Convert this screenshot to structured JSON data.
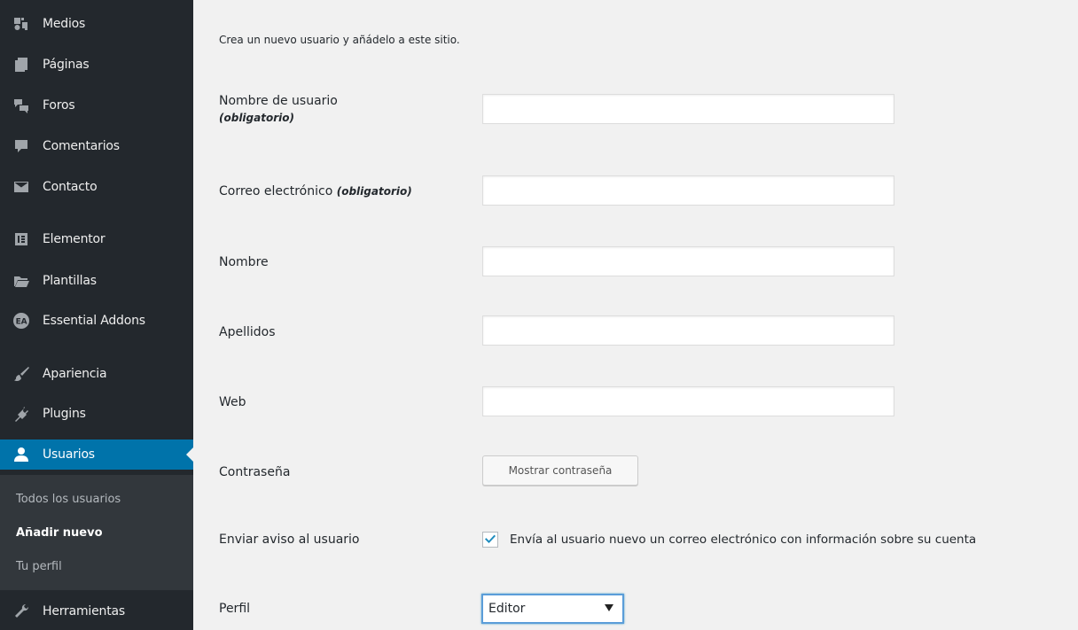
{
  "sidebar": {
    "items": [
      {
        "label": "Medios",
        "icon": "media-icon"
      },
      {
        "label": "Páginas",
        "icon": "pages-icon"
      },
      {
        "label": "Foros",
        "icon": "forums-icon"
      },
      {
        "label": "Comentarios",
        "icon": "comments-icon"
      },
      {
        "label": "Contacto",
        "icon": "mail-icon"
      },
      {
        "label": "Elementor",
        "icon": "elementor-icon"
      },
      {
        "label": "Plantillas",
        "icon": "folder-icon"
      },
      {
        "label": "Essential Addons",
        "icon": "ea-icon"
      },
      {
        "label": "Apariencia",
        "icon": "brush-icon"
      },
      {
        "label": "Plugins",
        "icon": "plugin-icon"
      },
      {
        "label": "Usuarios",
        "icon": "user-icon",
        "current": true
      },
      {
        "label": "Herramientas",
        "icon": "wrench-icon"
      }
    ],
    "submenu": [
      {
        "label": "Todos los usuarios"
      },
      {
        "label": "Añadir nuevo",
        "current": true
      },
      {
        "label": "Tu perfil"
      }
    ]
  },
  "form": {
    "intro": "Crea un nuevo usuario y añádelo a este sitio.",
    "username_label": "Nombre de usuario",
    "username_required": "(obligatorio)",
    "username_value": "",
    "email_label": "Correo electrónico",
    "email_required": "(obligatorio)",
    "email_value": "",
    "first_name_label": "Nombre",
    "first_name_value": "",
    "last_name_label": "Apellidos",
    "last_name_value": "",
    "web_label": "Web",
    "web_value": "",
    "password_label": "Contraseña",
    "show_password_button": "Mostrar contraseña",
    "notify_label": "Enviar aviso al usuario",
    "notify_checked": true,
    "notify_text": "Envía al usuario nuevo un correo electrónico con información sobre su cuenta",
    "role_label": "Perfil",
    "role_value": "Editor"
  },
  "colors": {
    "sidebar_bg": "#23282d",
    "submenu_bg": "#32373c",
    "accent": "#0073aa",
    "check": "#1e8cbe"
  }
}
